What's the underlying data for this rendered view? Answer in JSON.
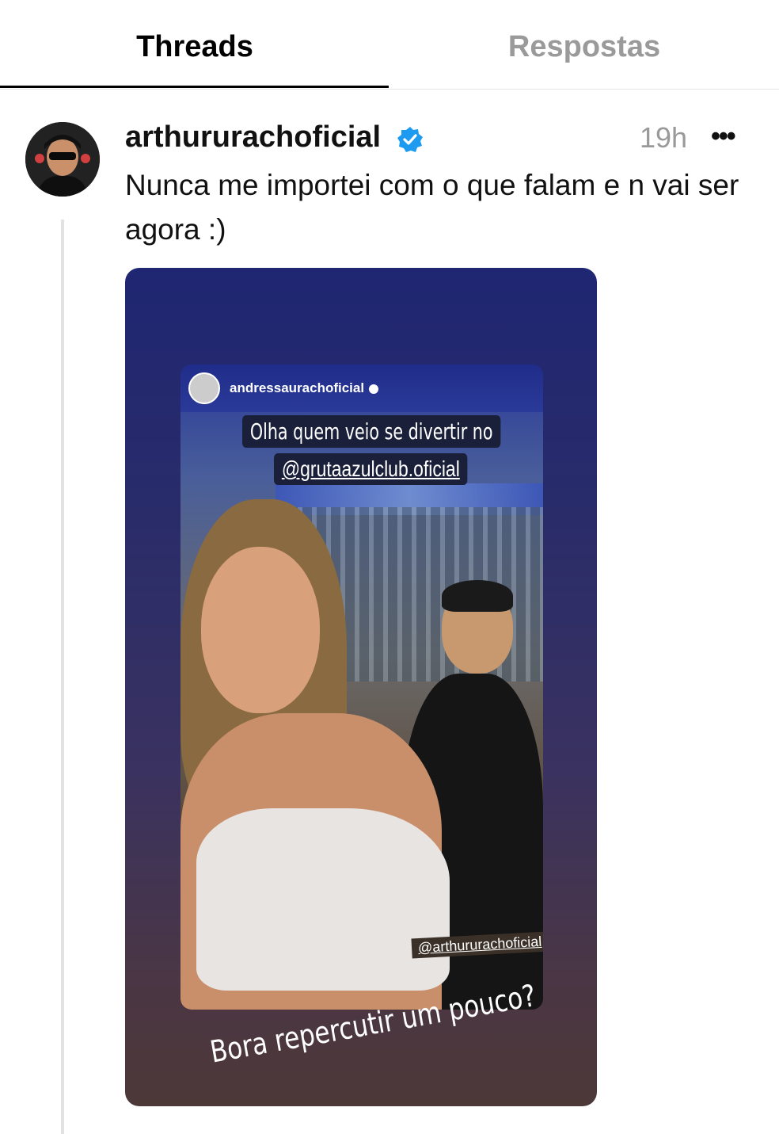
{
  "tabs": [
    {
      "label": "Threads",
      "active": true
    },
    {
      "label": "Respostas",
      "active": false
    }
  ],
  "post": {
    "username": "arthururachoficial",
    "verified": true,
    "time": "19h",
    "more_icon": "more-horizontal-icon",
    "text": "Nunca me importei com o que falam e n vai ser agora :)",
    "media": {
      "story_username": "andressaurachoficial",
      "caption_line1": "Olha quem veio se divertir no",
      "caption_line2": "@grutaazulclub.oficial",
      "tag": "@arthururachoficial",
      "bottom_caption": "Bora repercutir um pouco?"
    }
  },
  "colors": {
    "verified_blue": "#1d9bf0",
    "inactive_tab": "#9a9a9a",
    "timestamp": "#999999"
  }
}
